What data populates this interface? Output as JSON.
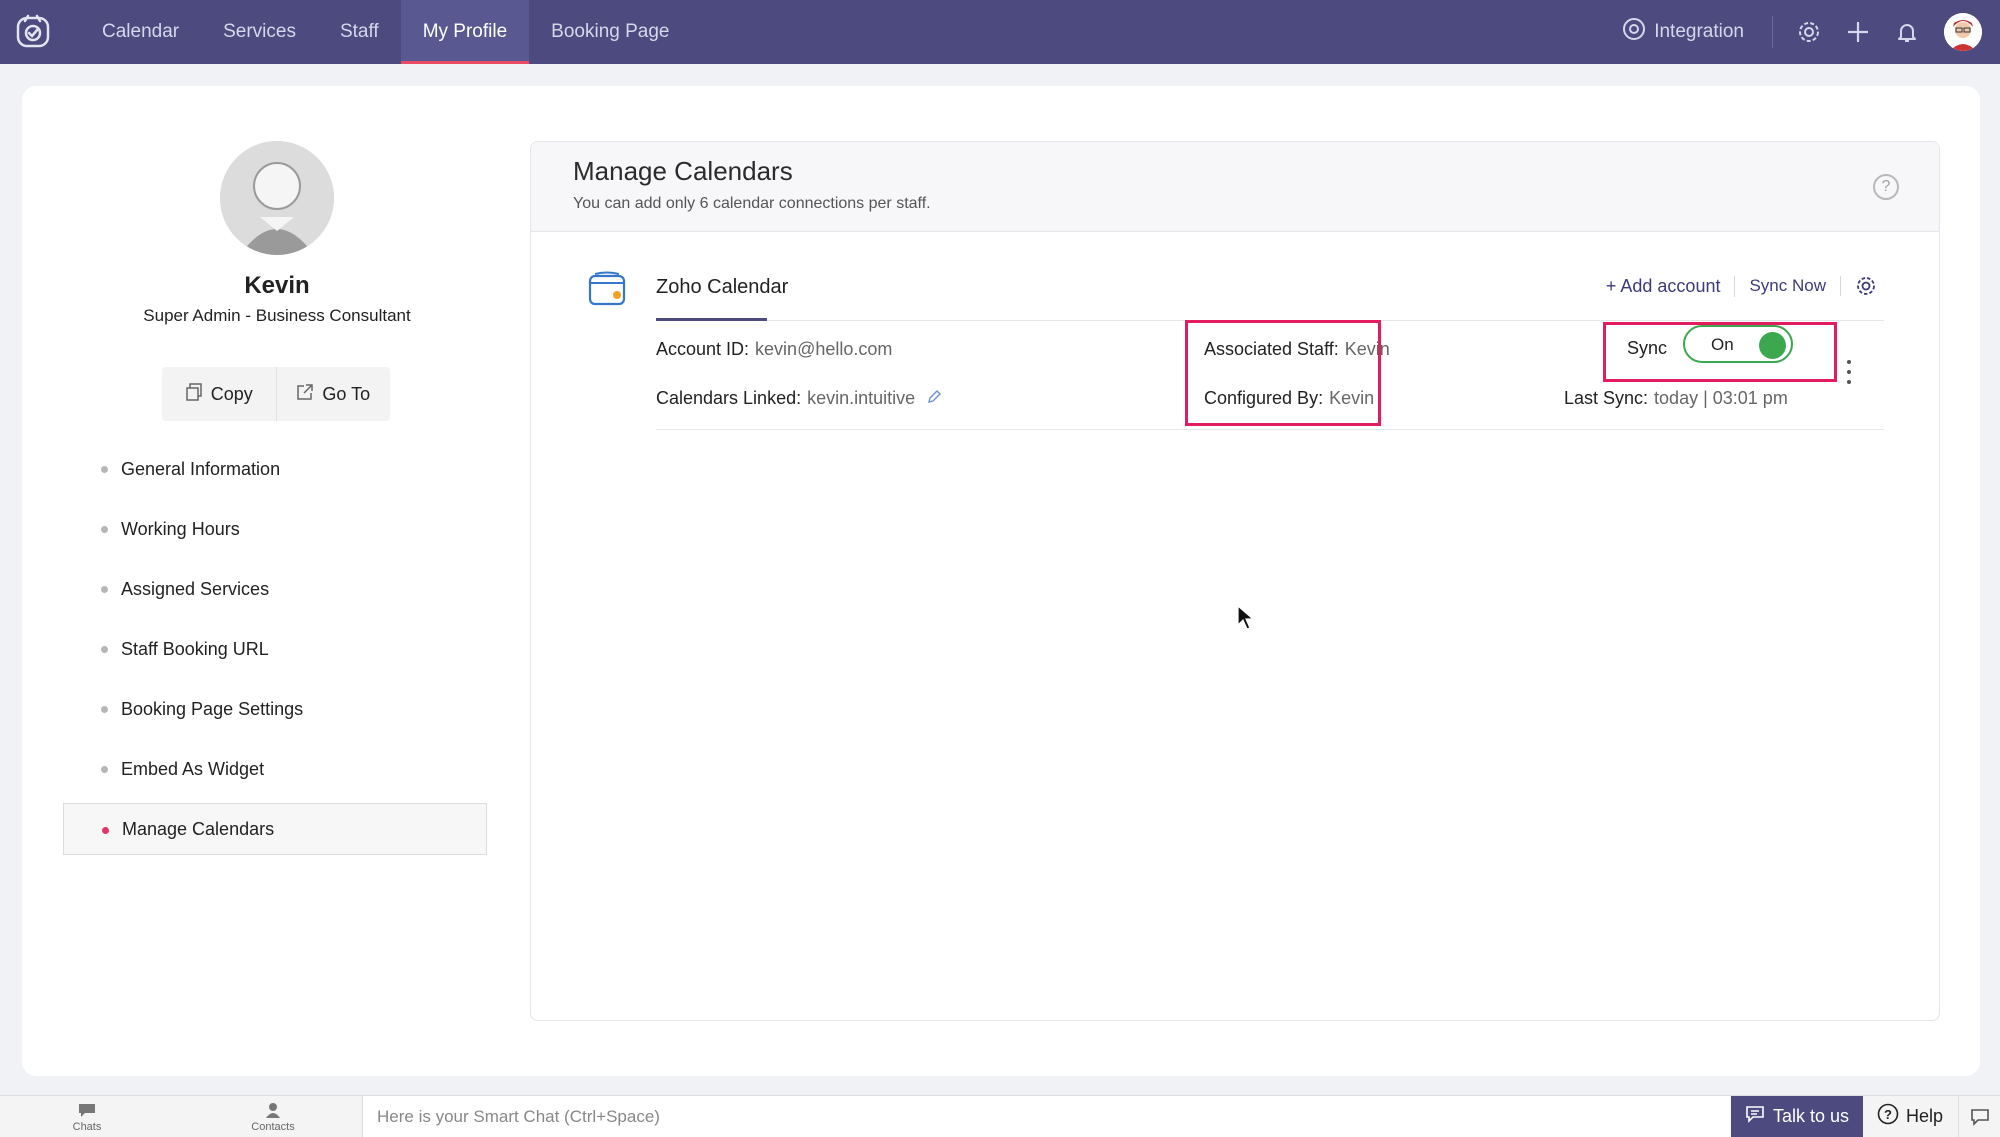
{
  "topbar": {
    "logo_icon": "app-logo-icon",
    "nav": [
      {
        "label": "Calendar"
      },
      {
        "label": "Services"
      },
      {
        "label": "Staff"
      },
      {
        "label": "My Profile"
      },
      {
        "label": "Booking Page"
      }
    ],
    "active_nav": "My Profile",
    "integration_label": "Integration",
    "icons": [
      "gear-icon",
      "plus-icon",
      "bell-icon",
      "user-avatar"
    ]
  },
  "profile": {
    "name": "Kevin",
    "role": "Super Admin - Business Consultant",
    "copy_label": "Copy",
    "goto_label": "Go To"
  },
  "side_menu": {
    "items": [
      {
        "label": "General Information"
      },
      {
        "label": "Working Hours"
      },
      {
        "label": "Assigned Services"
      },
      {
        "label": "Staff Booking URL"
      },
      {
        "label": "Booking Page Settings"
      },
      {
        "label": "Embed As Widget"
      },
      {
        "label": "Manage Calendars"
      }
    ],
    "active": "Manage Calendars"
  },
  "panel": {
    "title": "Manage Calendars",
    "subtitle": "You can add only 6 calendar connections per staff.",
    "help_glyph": "?"
  },
  "calendar": {
    "name": "Zoho Calendar",
    "add_account_label": "+ Add account",
    "sync_now_label": "Sync Now",
    "account_id_label": "Account ID:",
    "account_id_value": "kevin@hello.com",
    "calendars_linked_label": "Calendars Linked:",
    "calendars_linked_value": "kevin.intuitive",
    "associated_staff_label": "Associated Staff:",
    "associated_staff_value": "Kevin",
    "configured_by_label": "Configured By:",
    "configured_by_value": "Kevin",
    "sync_label": "Sync",
    "sync_state": "On",
    "last_sync_label": "Last Sync:",
    "last_sync_value": "today | 03:01 pm"
  },
  "bottombar": {
    "chats_label": "Chats",
    "contacts_label": "Contacts",
    "smart_chat_placeholder": "Here is your Smart Chat (Ctrl+Space)",
    "talk_label": "Talk to us",
    "help_label": "Help"
  },
  "colors": {
    "topbar": "#4c4a7e",
    "active_underline": "#e84b63",
    "highlight_box": "#e31c5f",
    "toggle_on": "#3ba84f",
    "link": "#3c3a7a"
  }
}
